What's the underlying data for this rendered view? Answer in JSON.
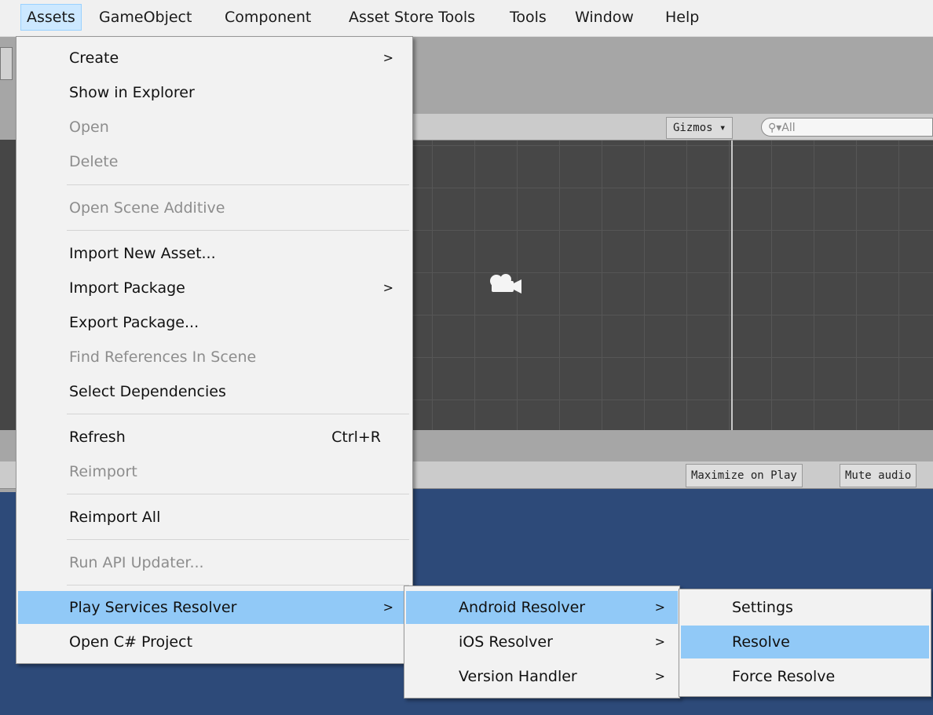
{
  "menubar": [
    "Assets",
    "GameObject",
    "Component",
    "Asset Store Tools",
    "Tools",
    "Window",
    "Help"
  ],
  "scene": {
    "gizmos": "Gizmos ▾",
    "search_placeholder": "All"
  },
  "game": {
    "maximize_on_play": "Maximize on Play",
    "mute_audio": "Mute audio"
  },
  "assets_menu": {
    "create": "Create",
    "show_in_explorer": "Show in Explorer",
    "open": "Open",
    "delete": "Delete",
    "open_scene_additive": "Open Scene Additive",
    "import_new_asset": "Import New Asset...",
    "import_package": "Import Package",
    "export_package": "Export Package...",
    "find_references": "Find References In Scene",
    "select_dependencies": "Select Dependencies",
    "refresh": "Refresh",
    "refresh_shortcut": "Ctrl+R",
    "reimport": "Reimport",
    "reimport_all": "Reimport All",
    "run_api_updater": "Run API Updater...",
    "play_services_resolver": "Play Services Resolver",
    "open_csharp_project": "Open C# Project"
  },
  "resolver_menu": {
    "android": "Android Resolver",
    "ios": "iOS Resolver",
    "version_handler": "Version Handler"
  },
  "android_menu": {
    "settings": "Settings",
    "resolve": "Resolve",
    "force_resolve": "Force Resolve"
  },
  "arrow": ">",
  "colors": {
    "highlight": "#91c9f7",
    "menubar_active": "#cce8ff",
    "game_bg": "#2d4a79",
    "scene_bg": "#474747"
  }
}
